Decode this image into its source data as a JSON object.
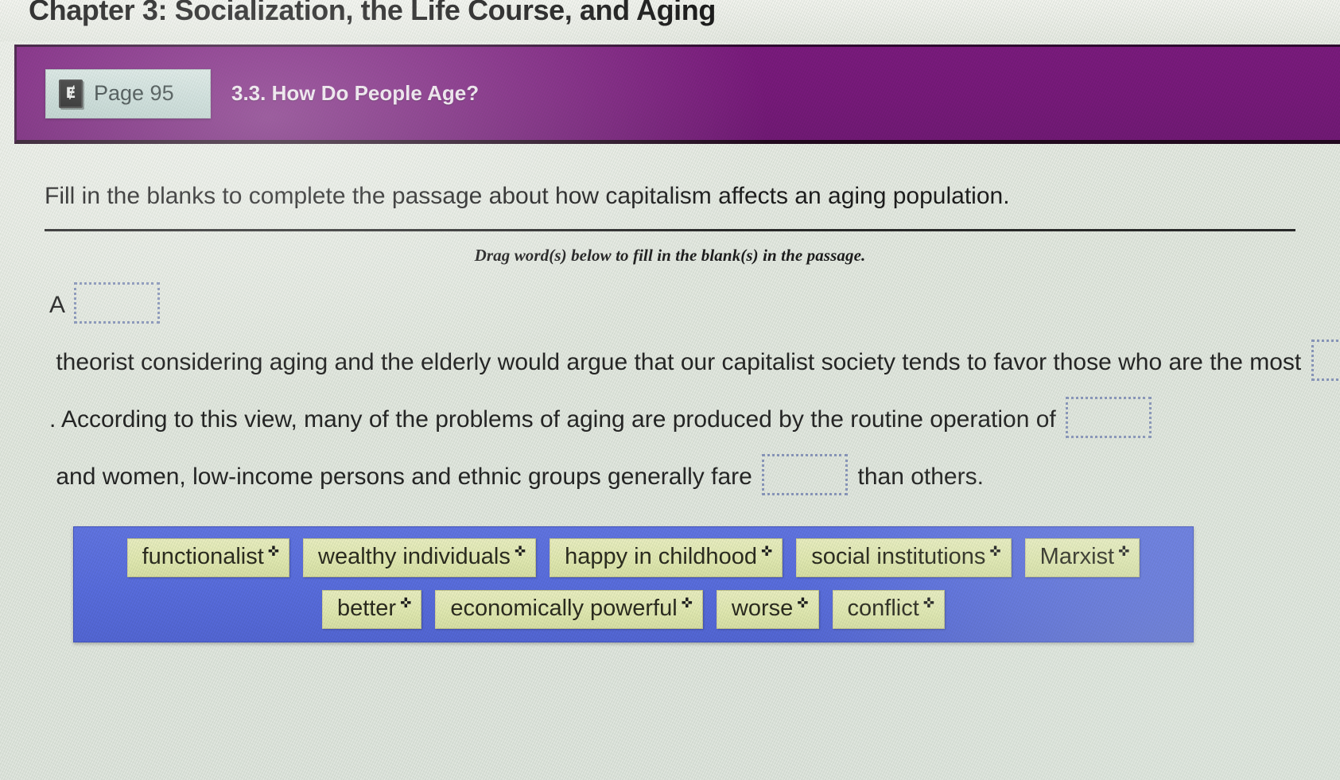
{
  "chapter": {
    "title": "Chapter 3: Socialization, the Life Course, and Aging"
  },
  "section_bar": {
    "page_chip": {
      "icon": "ebook-icon",
      "icon_glyph": "Ɇ",
      "label": "Page 95"
    },
    "section_label": "3.3. How Do People Age?",
    "bar_color": "#7a1a7d",
    "chip_color": "#c9dcd9"
  },
  "question": {
    "prompt": "Fill in the blanks to complete the passage about how capitalism affects an aging population.",
    "drag_hint": "Drag word(s) below to fill in the blank(s) in the passage.",
    "passage_parts": [
      {
        "type": "text",
        "value": "A "
      },
      {
        "type": "blank",
        "value": ""
      },
      {
        "type": "text",
        "value": " theorist considering aging and the elderly would argue that our capitalist society tends to favor those who are the most "
      },
      {
        "type": "blank",
        "value": ""
      },
      {
        "type": "text",
        "value": ". According to this view, many of the problems of aging are produced by the routine operation of "
      },
      {
        "type": "blank",
        "value": ""
      },
      {
        "type": "text",
        "value": " and women, low-income persons and ethnic groups generally fare "
      },
      {
        "type": "blank",
        "value": ""
      },
      {
        "type": "text",
        "value": " than others."
      }
    ]
  },
  "word_bank": {
    "background_color": "#5a6ee2",
    "tile_color": "#e6ecb5",
    "move_cursor_glyph": "✜",
    "rows": [
      [
        {
          "label": "functionalist"
        },
        {
          "label": "wealthy individuals"
        },
        {
          "label": "happy in childhood"
        },
        {
          "label": "social institutions"
        },
        {
          "label": "Marxist"
        }
      ],
      [
        {
          "label": "better"
        },
        {
          "label": "economically powerful"
        },
        {
          "label": "worse"
        },
        {
          "label": "conflict"
        }
      ]
    ]
  }
}
